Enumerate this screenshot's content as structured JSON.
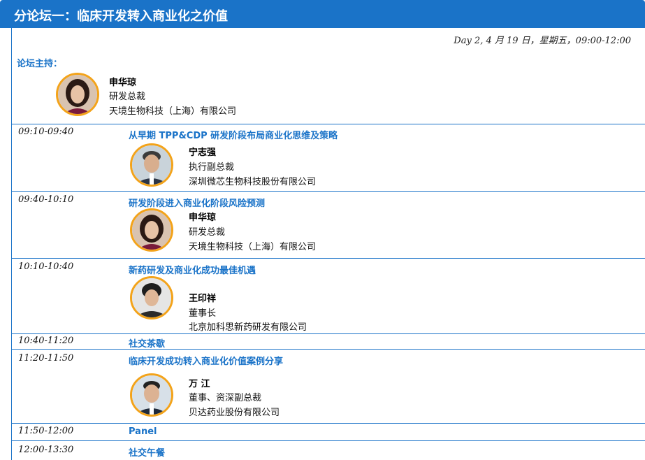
{
  "header": {
    "title": "分论坛一：临床开发转入商业化之价值"
  },
  "day_line": "Day 2, 4 月 19 日，星期五，09:00-12:00",
  "moderator": {
    "label": "论坛主持：",
    "name": "申华琼",
    "title": "研发总裁",
    "company": "天境生物科技（上海）有限公司"
  },
  "sessions": [
    {
      "time": "09:10-09:40",
      "topic": "从早期 TPP&CDP 研发阶段布局商业化思维及策略",
      "speaker": {
        "name": "宁志强",
        "title": "执行副总裁",
        "company": "深圳微芯生物科技股份有限公司"
      }
    },
    {
      "time": "09:40-10:10",
      "topic": "研发阶段进入商业化阶段风险预测",
      "speaker": {
        "name": "申华琼",
        "title": "研发总裁",
        "company": "天境生物科技（上海）有限公司"
      }
    },
    {
      "time": "10:10-10:40",
      "topic": "新药研发及商业化成功最佳机遇",
      "speaker": {
        "name": "王印祥",
        "title": "董事长",
        "company": "北京加科思新药研发有限公司"
      }
    },
    {
      "time": "10:40-11:20",
      "topic": "社交茶歇"
    },
    {
      "time": "11:20-11:50",
      "topic": "临床开发成功转入商业化价值案例分享",
      "speaker": {
        "name": "万 江",
        "title": "董事、资深副总裁",
        "company": "贝达药业股份有限公司"
      }
    },
    {
      "time": "11:50-12:00",
      "topic": "Panel"
    },
    {
      "time": "12:00-13:30",
      "topic": "社交午餐"
    }
  ],
  "colors": {
    "header": "#1a73c8",
    "accent": "#1a73c8",
    "avatar_ring": "#f3a31a"
  }
}
